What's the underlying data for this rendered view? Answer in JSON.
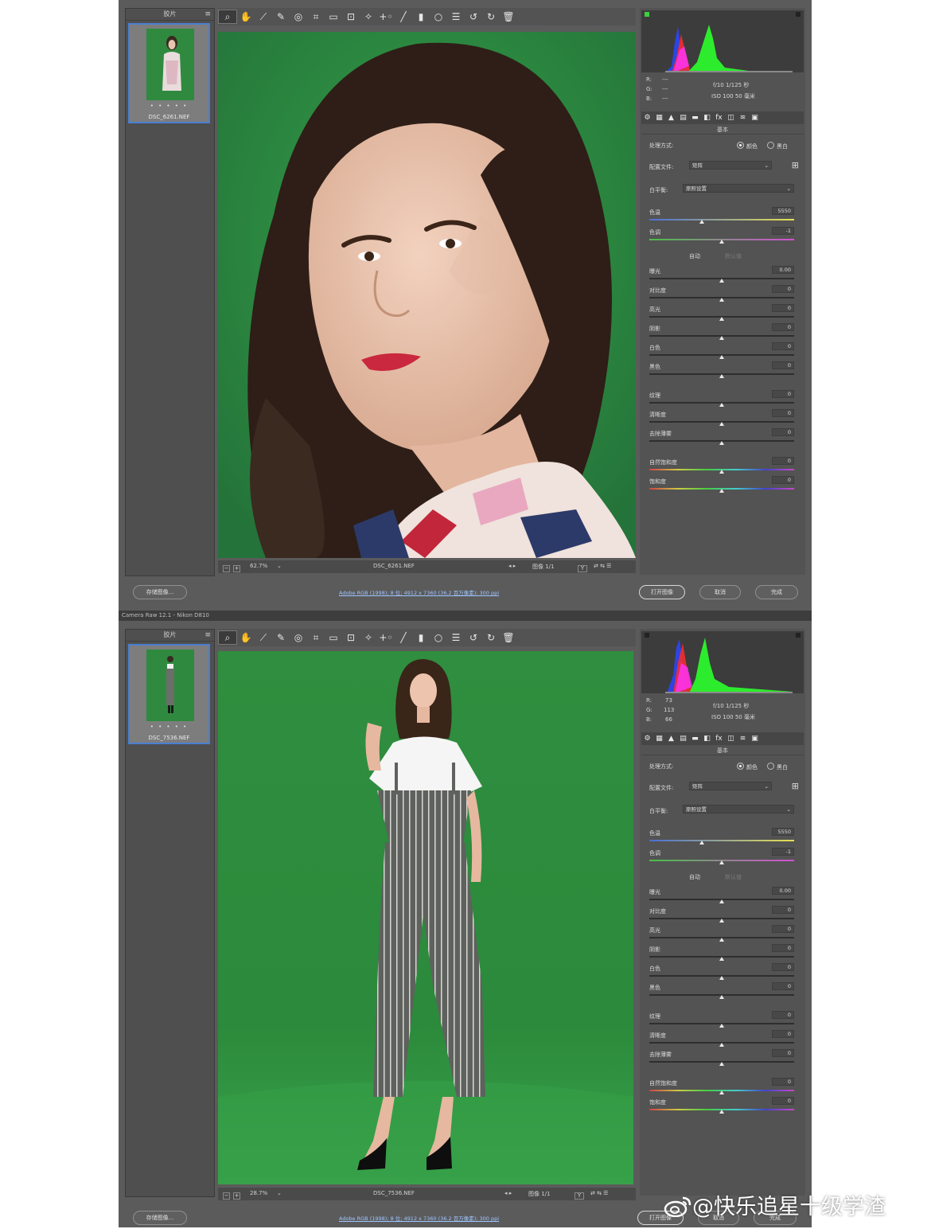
{
  "windows": [
    {
      "filmstrip": {
        "title": "胶片",
        "thumb_name": "DSC_6261.NEF",
        "stars": "• • • • •"
      },
      "status": {
        "zoom": "62.7%",
        "filename": "DSC_6261.NEF",
        "image_count": "图像 1/1"
      },
      "readout": {
        "r_label": "R:",
        "g_label": "G:",
        "b_label": "B:",
        "r": "---",
        "g": "---",
        "b": "---",
        "exposure": "f/10   1/125 秒",
        "iso": "ISO 100   50 毫米"
      },
      "workflow": "Adobe RGB (1998); 8 位; 4912 x 7360 (36.2 百万像素); 300 ppi"
    },
    {
      "filmstrip": {
        "title": "胶片",
        "thumb_name": "DSC_7536.NEF",
        "stars": "• • • • •"
      },
      "status": {
        "zoom": "28.7%",
        "filename": "DSC_7536.NEF",
        "image_count": "图像 1/1"
      },
      "readout": {
        "r_label": "R:",
        "g_label": "G:",
        "b_label": "B:",
        "r": "73",
        "g": "113",
        "b": "66",
        "exposure": "f/10   1/125 秒",
        "iso": "ISO 100   50 毫米"
      },
      "workflow": "Adobe RGB (1998); 8 位; 4912 x 7360 (36.2 百万像素); 300 ppi"
    }
  ],
  "window_title": "Camera Raw 12.1 - Nikon D810",
  "panel": {
    "section_title": "基本",
    "treatment_label": "处理方式:",
    "treatment_color": "颜色",
    "treatment_bw": "黑白",
    "profile_label": "配置文件:",
    "profile_value": "矩阵",
    "wb_label": "白平衡:",
    "wb_value": "原照设置",
    "auto": "自动",
    "default": "默认值",
    "sliders": [
      {
        "label": "色温",
        "value": "5550",
        "pos": 0.36,
        "kind": "temp"
      },
      {
        "label": "色调",
        "value": "-1",
        "pos": 0.5,
        "kind": "tint"
      },
      {
        "label": "曝光",
        "value": "0.00",
        "pos": 0.5,
        "kind": "plain"
      },
      {
        "label": "对比度",
        "value": "0",
        "pos": 0.5,
        "kind": "plain"
      },
      {
        "label": "高光",
        "value": "0",
        "pos": 0.5,
        "kind": "plain"
      },
      {
        "label": "阴影",
        "value": "0",
        "pos": 0.5,
        "kind": "plain"
      },
      {
        "label": "白色",
        "value": "0",
        "pos": 0.5,
        "kind": "plain"
      },
      {
        "label": "黑色",
        "value": "0",
        "pos": 0.5,
        "kind": "plain"
      },
      {
        "label": "纹理",
        "value": "0",
        "pos": 0.5,
        "kind": "plain"
      },
      {
        "label": "清晰度",
        "value": "0",
        "pos": 0.5,
        "kind": "plain"
      },
      {
        "label": "去除薄雾",
        "value": "0",
        "pos": 0.5,
        "kind": "plain"
      },
      {
        "label": "自然饱和度",
        "value": "0",
        "pos": 0.5,
        "kind": "sat"
      },
      {
        "label": "饱和度",
        "value": "0",
        "pos": 0.5,
        "kind": "sat"
      }
    ]
  },
  "buttons": {
    "save": "存储图像...",
    "open": "打开图像",
    "cancel": "取消",
    "done": "完成"
  },
  "watermark": "@快乐追星十级学渣",
  "colors": {
    "backdrop_green": "#2d8a3c",
    "panel_gray": "#535353",
    "accent_blue": "#4a7fd1"
  }
}
